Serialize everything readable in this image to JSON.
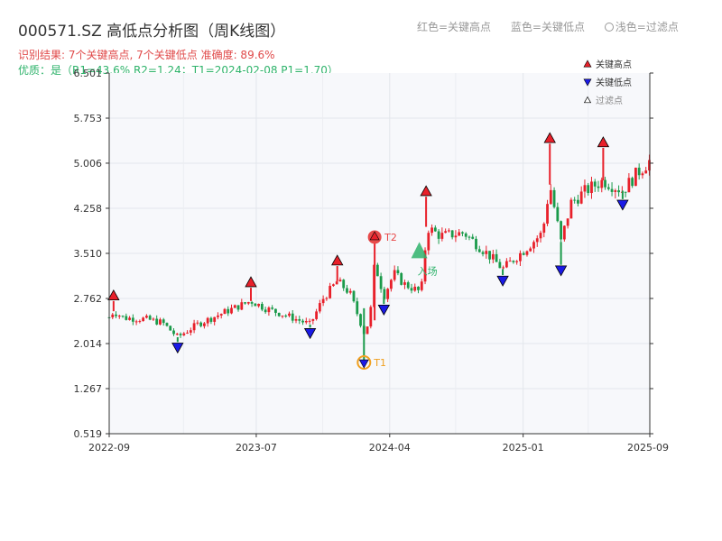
{
  "header": {
    "title": "000571.SZ 高低点分析图（周K线图）",
    "legend_red": "红色=关键高点",
    "legend_blue": "蓝色=关键低点",
    "legend_hollow": "浅色=过滤点",
    "result_line": "识别结果: 7个关键高点, 7个关键低点  准确度: 89.6%",
    "quality_line": "优质：是（R1=43.6%  R2=1.24；T1=2024-02-08 P1=1.70）"
  },
  "legend": {
    "high": "关键高点",
    "low": "关键低点",
    "filtered": "过滤点"
  },
  "colors": {
    "up": "#e8202a",
    "down": "#1a9a4a",
    "high_marker": "#e8202a",
    "low_marker": "#1a1ae6",
    "t1": "#f0a020",
    "t2": "#e84a4a",
    "entry": "#2fb36b",
    "plot_bg": "#f7f8fb"
  },
  "chart_data": {
    "type": "candlestick",
    "x_ticks": [
      "2022-09",
      "2023-07",
      "2024-04",
      "2025-01",
      "2025-09"
    ],
    "y_ticks": [
      "0.519",
      "1.267",
      "2.014",
      "2.762",
      "3.510",
      "4.258",
      "5.006",
      "5.753",
      "6.501"
    ],
    "ylim": [
      0.519,
      6.501
    ],
    "x_range": [
      "2022-09-01",
      "2025-09-19"
    ],
    "key_highs": [
      {
        "date": "2022-09-10",
        "value": 2.72
      },
      {
        "date": "2023-06-20",
        "value": 2.94
      },
      {
        "date": "2023-12-15",
        "value": 3.3
      },
      {
        "date": "2024-06-15",
        "value": 4.45
      },
      {
        "date": "2025-02-25",
        "value": 5.33
      },
      {
        "date": "2025-06-15",
        "value": 5.26
      }
    ],
    "key_lows": [
      {
        "date": "2023-01-20",
        "value": 2.04
      },
      {
        "date": "2023-10-20",
        "value": 2.28
      },
      {
        "date": "2024-03-20",
        "value": 2.67
      },
      {
        "date": "2024-11-20",
        "value": 3.15
      },
      {
        "date": "2025-03-20",
        "value": 3.32
      },
      {
        "date": "2025-07-25",
        "value": 4.41
      }
    ],
    "t1": {
      "label": "T1",
      "date": "2024-02-08",
      "value": 1.7
    },
    "t2": {
      "label": "T2",
      "date": "2024-03-01",
      "value": 3.78
    },
    "entry": {
      "label": "入场",
      "date": "2024-06-01",
      "value": 3.52
    },
    "price_path": [
      [
        "2022-09-01",
        2.45
      ],
      [
        "2022-09-10",
        2.55
      ],
      [
        "2022-10-01",
        2.44
      ],
      [
        "2022-11-15",
        2.42
      ],
      [
        "2022-12-20",
        2.36
      ],
      [
        "2023-01-20",
        2.12
      ],
      [
        "2023-03-01",
        2.33
      ],
      [
        "2023-05-01",
        2.55
      ],
      [
        "2023-06-20",
        2.72
      ],
      [
        "2023-07-20",
        2.6
      ],
      [
        "2023-09-01",
        2.48
      ],
      [
        "2023-10-20",
        2.33
      ],
      [
        "2023-11-15",
        2.75
      ],
      [
        "2023-12-15",
        3.05
      ],
      [
        "2024-01-10",
        2.85
      ],
      [
        "2024-02-08",
        2.2
      ],
      [
        "2024-02-20",
        2.4
      ],
      [
        "2024-03-01",
        3.35
      ],
      [
        "2024-03-20",
        2.8
      ],
      [
        "2024-04-10",
        3.18
      ],
      [
        "2024-05-01",
        3.0
      ],
      [
        "2024-06-01",
        2.88
      ],
      [
        "2024-06-10",
        3.05
      ],
      [
        "2024-06-15",
        3.95
      ],
      [
        "2024-07-15",
        3.8
      ],
      [
        "2024-09-01",
        3.85
      ],
      [
        "2024-10-20",
        3.5
      ],
      [
        "2024-11-20",
        3.25
      ],
      [
        "2025-01-01",
        3.55
      ],
      [
        "2025-02-10",
        3.85
      ],
      [
        "2025-02-25",
        4.65
      ],
      [
        "2025-03-20",
        3.7
      ],
      [
        "2025-04-10",
        4.35
      ],
      [
        "2025-05-10",
        4.55
      ],
      [
        "2025-06-15",
        4.72
      ],
      [
        "2025-07-25",
        4.55
      ],
      [
        "2025-08-25",
        4.85
      ],
      [
        "2025-09-19",
        5.05
      ]
    ]
  }
}
